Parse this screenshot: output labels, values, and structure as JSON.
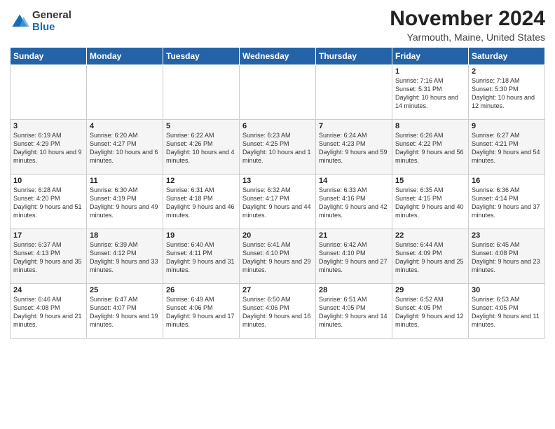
{
  "header": {
    "logo_general": "General",
    "logo_blue": "Blue",
    "month_title": "November 2024",
    "location": "Yarmouth, Maine, United States"
  },
  "days_of_week": [
    "Sunday",
    "Monday",
    "Tuesday",
    "Wednesday",
    "Thursday",
    "Friday",
    "Saturday"
  ],
  "weeks": [
    [
      {
        "day": "",
        "info": ""
      },
      {
        "day": "",
        "info": ""
      },
      {
        "day": "",
        "info": ""
      },
      {
        "day": "",
        "info": ""
      },
      {
        "day": "",
        "info": ""
      },
      {
        "day": "1",
        "info": "Sunrise: 7:16 AM\nSunset: 5:31 PM\nDaylight: 10 hours and 14 minutes."
      },
      {
        "day": "2",
        "info": "Sunrise: 7:18 AM\nSunset: 5:30 PM\nDaylight: 10 hours and 12 minutes."
      }
    ],
    [
      {
        "day": "3",
        "info": "Sunrise: 6:19 AM\nSunset: 4:29 PM\nDaylight: 10 hours and 9 minutes."
      },
      {
        "day": "4",
        "info": "Sunrise: 6:20 AM\nSunset: 4:27 PM\nDaylight: 10 hours and 6 minutes."
      },
      {
        "day": "5",
        "info": "Sunrise: 6:22 AM\nSunset: 4:26 PM\nDaylight: 10 hours and 4 minutes."
      },
      {
        "day": "6",
        "info": "Sunrise: 6:23 AM\nSunset: 4:25 PM\nDaylight: 10 hours and 1 minute."
      },
      {
        "day": "7",
        "info": "Sunrise: 6:24 AM\nSunset: 4:23 PM\nDaylight: 9 hours and 59 minutes."
      },
      {
        "day": "8",
        "info": "Sunrise: 6:26 AM\nSunset: 4:22 PM\nDaylight: 9 hours and 56 minutes."
      },
      {
        "day": "9",
        "info": "Sunrise: 6:27 AM\nSunset: 4:21 PM\nDaylight: 9 hours and 54 minutes."
      }
    ],
    [
      {
        "day": "10",
        "info": "Sunrise: 6:28 AM\nSunset: 4:20 PM\nDaylight: 9 hours and 51 minutes."
      },
      {
        "day": "11",
        "info": "Sunrise: 6:30 AM\nSunset: 4:19 PM\nDaylight: 9 hours and 49 minutes."
      },
      {
        "day": "12",
        "info": "Sunrise: 6:31 AM\nSunset: 4:18 PM\nDaylight: 9 hours and 46 minutes."
      },
      {
        "day": "13",
        "info": "Sunrise: 6:32 AM\nSunset: 4:17 PM\nDaylight: 9 hours and 44 minutes."
      },
      {
        "day": "14",
        "info": "Sunrise: 6:33 AM\nSunset: 4:16 PM\nDaylight: 9 hours and 42 minutes."
      },
      {
        "day": "15",
        "info": "Sunrise: 6:35 AM\nSunset: 4:15 PM\nDaylight: 9 hours and 40 minutes."
      },
      {
        "day": "16",
        "info": "Sunrise: 6:36 AM\nSunset: 4:14 PM\nDaylight: 9 hours and 37 minutes."
      }
    ],
    [
      {
        "day": "17",
        "info": "Sunrise: 6:37 AM\nSunset: 4:13 PM\nDaylight: 9 hours and 35 minutes."
      },
      {
        "day": "18",
        "info": "Sunrise: 6:39 AM\nSunset: 4:12 PM\nDaylight: 9 hours and 33 minutes."
      },
      {
        "day": "19",
        "info": "Sunrise: 6:40 AM\nSunset: 4:11 PM\nDaylight: 9 hours and 31 minutes."
      },
      {
        "day": "20",
        "info": "Sunrise: 6:41 AM\nSunset: 4:10 PM\nDaylight: 9 hours and 29 minutes."
      },
      {
        "day": "21",
        "info": "Sunrise: 6:42 AM\nSunset: 4:10 PM\nDaylight: 9 hours and 27 minutes."
      },
      {
        "day": "22",
        "info": "Sunrise: 6:44 AM\nSunset: 4:09 PM\nDaylight: 9 hours and 25 minutes."
      },
      {
        "day": "23",
        "info": "Sunrise: 6:45 AM\nSunset: 4:08 PM\nDaylight: 9 hours and 23 minutes."
      }
    ],
    [
      {
        "day": "24",
        "info": "Sunrise: 6:46 AM\nSunset: 4:08 PM\nDaylight: 9 hours and 21 minutes."
      },
      {
        "day": "25",
        "info": "Sunrise: 6:47 AM\nSunset: 4:07 PM\nDaylight: 9 hours and 19 minutes."
      },
      {
        "day": "26",
        "info": "Sunrise: 6:49 AM\nSunset: 4:06 PM\nDaylight: 9 hours and 17 minutes."
      },
      {
        "day": "27",
        "info": "Sunrise: 6:50 AM\nSunset: 4:06 PM\nDaylight: 9 hours and 16 minutes."
      },
      {
        "day": "28",
        "info": "Sunrise: 6:51 AM\nSunset: 4:05 PM\nDaylight: 9 hours and 14 minutes."
      },
      {
        "day": "29",
        "info": "Sunrise: 6:52 AM\nSunset: 4:05 PM\nDaylight: 9 hours and 12 minutes."
      },
      {
        "day": "30",
        "info": "Sunrise: 6:53 AM\nSunset: 4:05 PM\nDaylight: 9 hours and 11 minutes."
      }
    ]
  ]
}
